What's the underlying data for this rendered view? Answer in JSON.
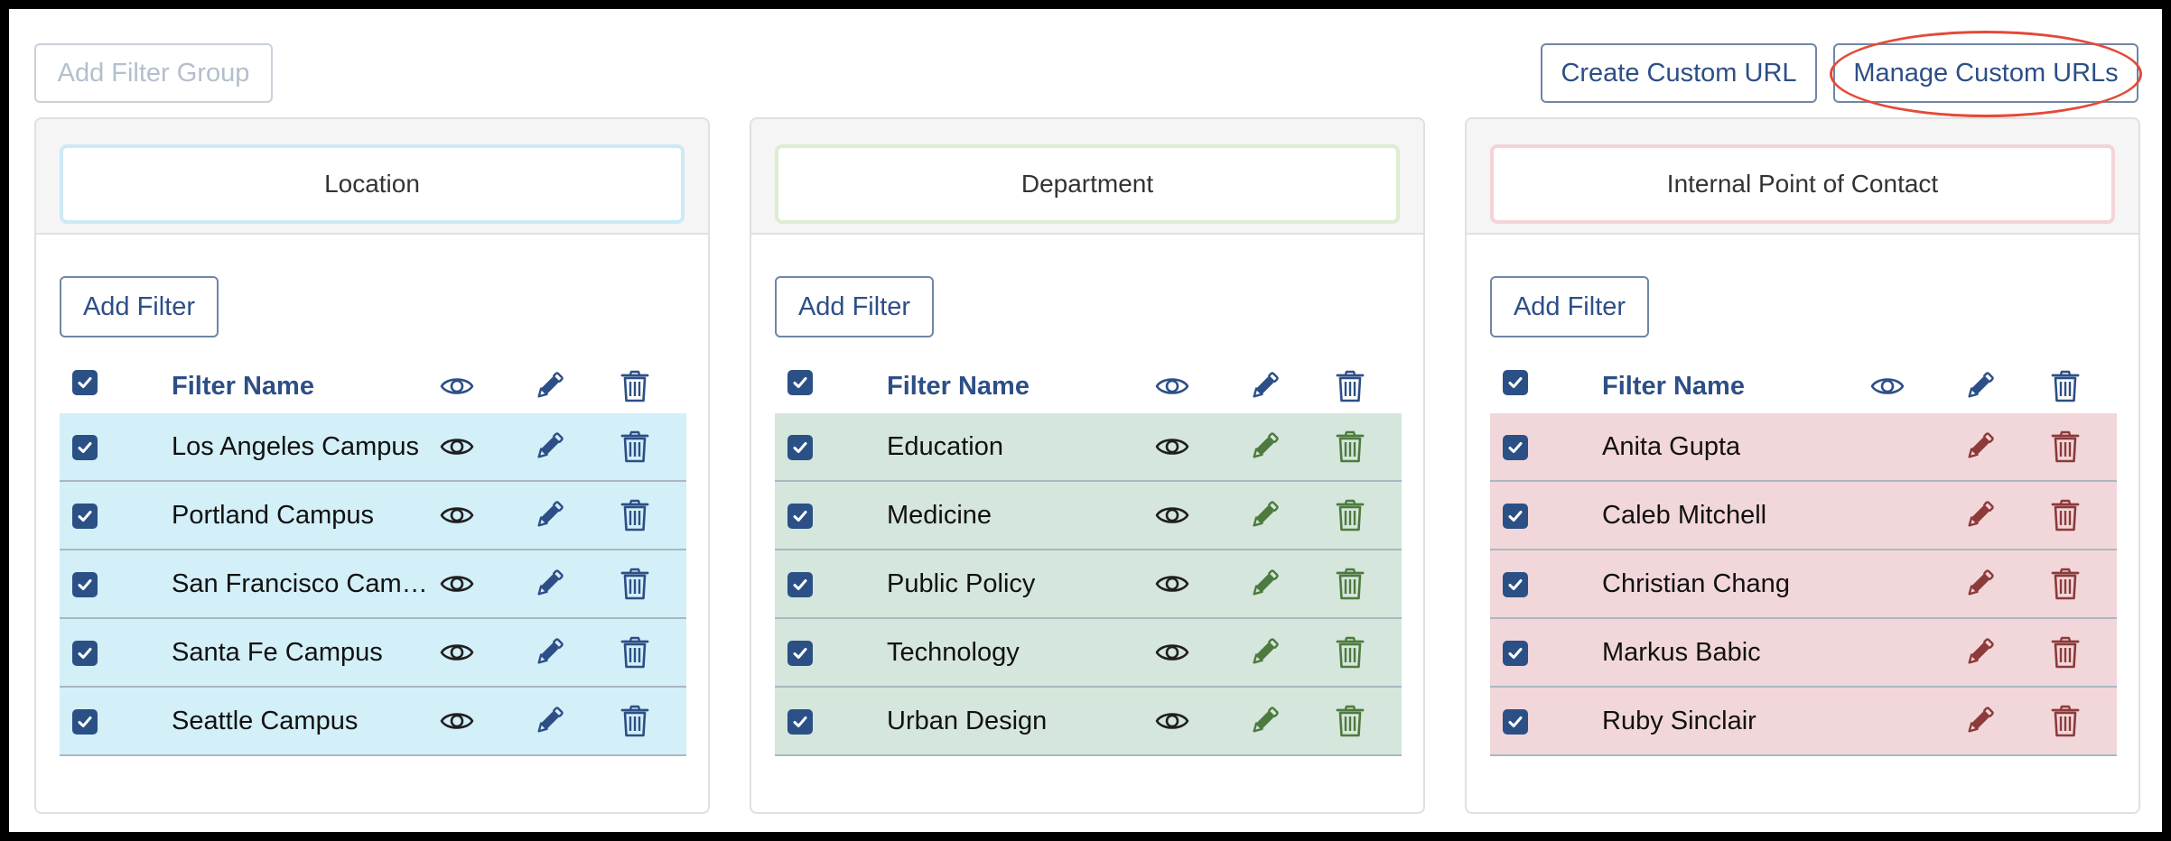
{
  "toolbar": {
    "add_group_label": "Add Filter Group",
    "create_url_label": "Create Custom URL",
    "manage_urls_label": "Manage Custom URLs"
  },
  "colors": {
    "brand_text": "#2d4f86",
    "highlight_ring": "#e34a38"
  },
  "icons": [
    "checkbox-checked-icon",
    "eye-icon",
    "pencil-icon",
    "trash-icon"
  ],
  "groups": [
    {
      "name": "Location",
      "add_filter_label": "Add Filter",
      "header_label": "Filter Name",
      "border_color": "#cde9f6",
      "row_bg": "#d3eff8",
      "action_color": "#2d4f86",
      "show_eye": true,
      "filters": [
        "Los Angeles Campus",
        "Portland Campus",
        "San Francisco Campus",
        "Santa Fe Campus",
        "Seattle Campus"
      ]
    },
    {
      "name": "Department",
      "add_filter_label": "Add Filter",
      "header_label": "Filter Name",
      "border_color": "#dcedd2",
      "row_bg": "#d5e6dc",
      "action_color": "#4d7a3e",
      "show_eye": true,
      "filters": [
        "Education",
        "Medicine",
        "Public Policy",
        "Technology",
        "Urban Design"
      ]
    },
    {
      "name": "Internal Point of Contact",
      "add_filter_label": "Add Filter",
      "header_label": "Filter Name",
      "border_color": "#f3d4d8",
      "row_bg": "#f2d7da",
      "action_color": "#8c3a3a",
      "show_eye": false,
      "filters": [
        "Anita Gupta",
        "Caleb Mitchell",
        "Christian Chang",
        "Markus Babic",
        "Ruby Sinclair"
      ]
    }
  ]
}
